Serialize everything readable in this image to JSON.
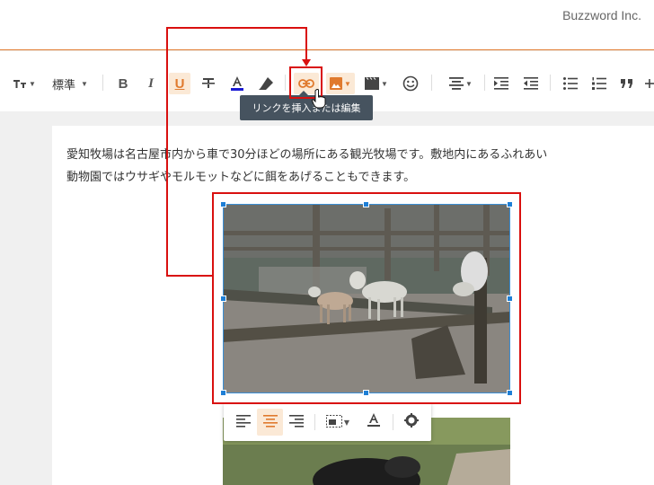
{
  "brand": "Buzzword Inc.",
  "toolbar": {
    "font_size_label": "tT",
    "style_label": "標準",
    "bold_label": "B",
    "italic_label": "I",
    "underline_label": "U",
    "accent_color": "#e07a2e",
    "icons": [
      "text-size-icon",
      "bold-icon",
      "italic-icon",
      "underline-icon",
      "strikethrough-icon",
      "text-color-icon",
      "highlight-icon",
      "link-icon",
      "image-icon",
      "video-icon",
      "emoji-icon",
      "align-icon",
      "indent-icon",
      "outdent-icon",
      "bulleted-list-icon",
      "numbered-list-icon",
      "quote-icon",
      "more-icon"
    ]
  },
  "tooltip": "リンクを挿入または編集",
  "content": {
    "paragraph_line1": "愛知牧場は名古屋市内から車で30分ほどの場所にある観光牧場です。敷地内にあるふれあい",
    "paragraph_line2": "動物園ではウサギやモルモットなどに餌をあげることもできます。"
  },
  "image_toolbar": {
    "icons": [
      "align-left-icon",
      "align-center-icon",
      "align-right-icon",
      "image-size-icon",
      "text-color-icon",
      "settings-icon"
    ]
  },
  "highlight_color": "#d9100f",
  "selection_color": "#1e7fd6"
}
